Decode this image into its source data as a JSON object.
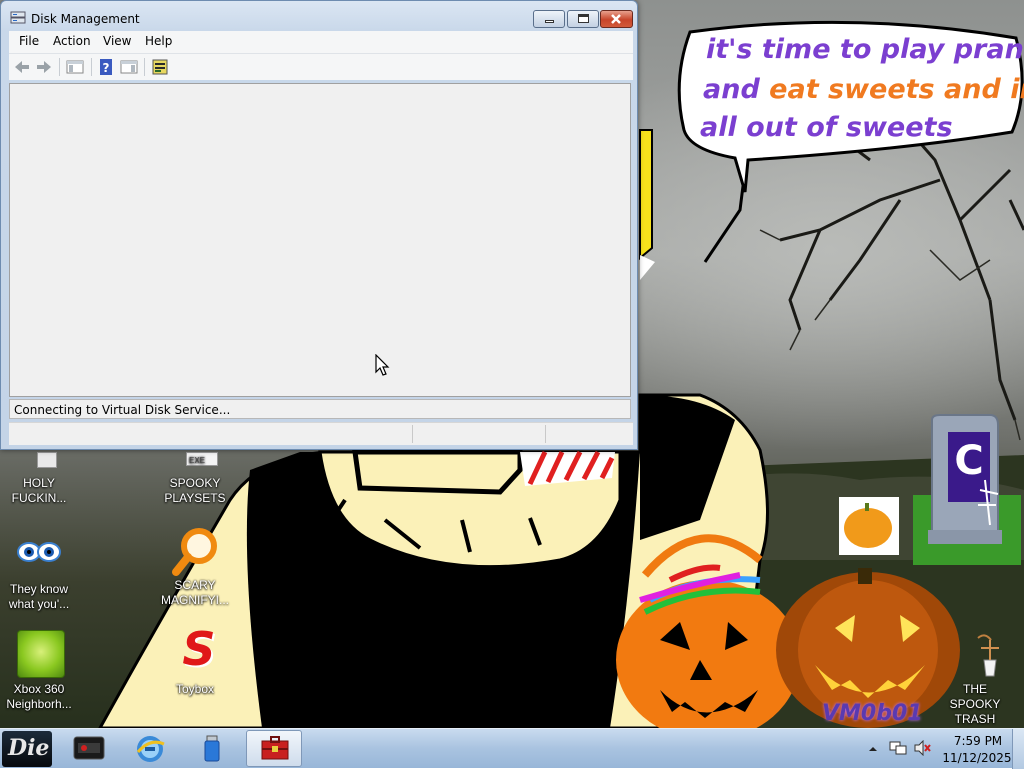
{
  "window": {
    "title": "Disk Management",
    "menu": [
      "File",
      "Action",
      "View",
      "Help"
    ],
    "status_message": "Connecting to Virtual Disk Service..."
  },
  "wallpaper": {
    "speech_line1": "it's time to play pranks",
    "speech_line2_a": "and ",
    "speech_line2_b": "eat sweets and im",
    "speech_line3": "all out of sweets",
    "tombstone_letter": "C",
    "watermark": "VM0b01"
  },
  "desktop_icons": [
    {
      "label": "HOLY FUCKIN...",
      "icon": "folder-icon"
    },
    {
      "label": "SPOOKY PLAYSETS",
      "icon": "exe-icon"
    },
    {
      "label": "They know what you'...",
      "icon": "eyes-icon"
    },
    {
      "label": "SCARY MAGNIFYI...",
      "icon": "magnifier-icon"
    },
    {
      "label": "Xbox 360 Neighborh...",
      "icon": "xbox-icon"
    },
    {
      "label": "Toybox",
      "icon": "toybox-icon"
    },
    {
      "label": "THE SPOOKY TRASH",
      "icon": "trash-icon"
    }
  ],
  "taskbar": {
    "start_label": "Die",
    "apps": [
      "media-center-icon",
      "internet-explorer-icon",
      "usb-icon",
      "disk-management-icon"
    ],
    "time": "7:59 PM",
    "date": "11/12/2025"
  },
  "colors": {
    "speech_purple": "#7b3fd0",
    "speech_orange": "#f07a20",
    "taskbar": "#a9c3e0",
    "close_red": "#c8452a"
  }
}
